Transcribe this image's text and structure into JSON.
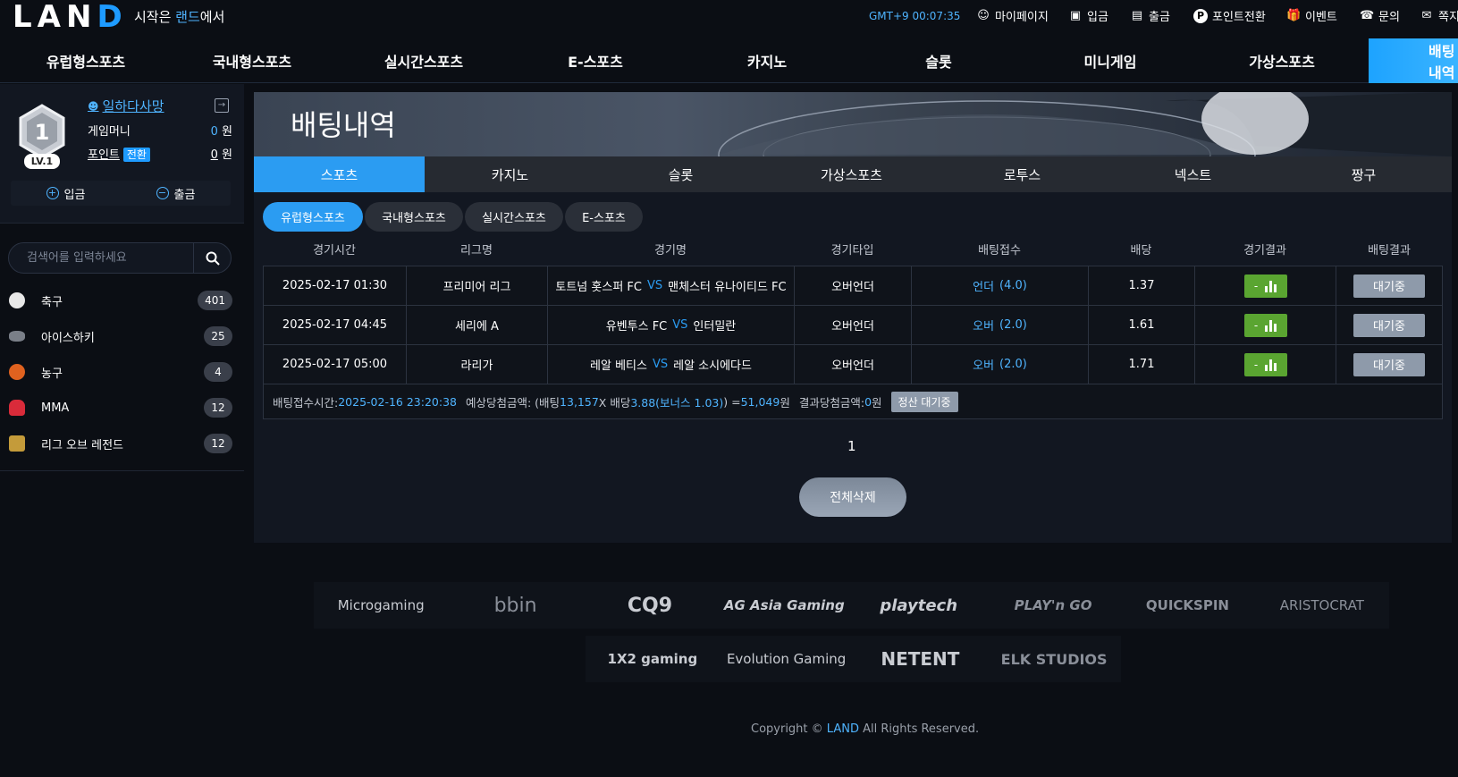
{
  "header": {
    "logo": "LAN",
    "logo_last": "D",
    "slogan_pre": "시작은 ",
    "slogan_brand": "랜드",
    "slogan_post": "에서",
    "clock": "GMT+9 00:07:35",
    "links": [
      {
        "label": "마이페이지",
        "icon": "user-icon"
      },
      {
        "label": "입금",
        "icon": "deposit-icon"
      },
      {
        "label": "출금",
        "icon": "withdraw-icon"
      },
      {
        "label": "포인트전환",
        "icon": "point-icon"
      },
      {
        "label": "이벤트",
        "icon": "gift-icon"
      },
      {
        "label": "문의",
        "icon": "headset-icon"
      },
      {
        "label": "쪽지",
        "icon": "mail-icon"
      }
    ]
  },
  "main_nav": {
    "items": [
      "유럽형스포츠",
      "국내형스포츠",
      "실시간스포츠",
      "E-스포츠",
      "카지노",
      "슬롯",
      "미니게임",
      "가상스포츠"
    ],
    "active": "배팅내역"
  },
  "user": {
    "level_num": "1",
    "level": "LV.1",
    "name": "일하다사망",
    "game_money_label": "게임머니",
    "game_money": "0",
    "currency": "원",
    "point_label": "포인트",
    "convert_label": "전환",
    "point": "0",
    "deposit_label": "입금",
    "withdraw_label": "출금"
  },
  "search": {
    "placeholder": "검색어를 입력하세요"
  },
  "sports": [
    {
      "name": "축구",
      "count": "401",
      "icon": "soccer-icon",
      "color": "#e8e8e8"
    },
    {
      "name": "아이스하키",
      "count": "25",
      "icon": "hockey-icon",
      "color": "#7a7f88"
    },
    {
      "name": "농구",
      "count": "4",
      "icon": "basketball-icon",
      "color": "#e0621f"
    },
    {
      "name": "MMA",
      "count": "12",
      "icon": "boxing-glove-icon",
      "color": "#d92b3a"
    },
    {
      "name": "리그 오브 레전드",
      "count": "12",
      "icon": "lol-icon",
      "color": "#c49b3a"
    }
  ],
  "page": {
    "title": "배팅내역",
    "categories": [
      "스포츠",
      "카지노",
      "슬롯",
      "가상스포츠",
      "로투스",
      "넥스트",
      "짱구"
    ],
    "subtabs": [
      "유럽형스포츠",
      "국내형스포츠",
      "실시간스포츠",
      "E-스포츠"
    ],
    "columns": [
      "경기시간",
      "리그명",
      "경기명",
      "경기타입",
      "배팅접수",
      "배당",
      "경기결과",
      "배팅결과"
    ],
    "rows": [
      {
        "time": "2025-02-17 01:30",
        "league": "프리미어 리그",
        "home": "토트넘 홋스퍼 FC",
        "vs": "VS",
        "away": "맨체스터 유나이티드 FC",
        "type": "오버언더",
        "pick": "언더",
        "pick_odd": "(4.0)",
        "odds": "1.37",
        "result": "-",
        "status": "대기중"
      },
      {
        "time": "2025-02-17 04:45",
        "league": "세리에 A",
        "home": "유벤투스 FC",
        "vs": "VS",
        "away": "인터밀란",
        "type": "오버언더",
        "pick": "오버",
        "pick_odd": "(2.0)",
        "odds": "1.61",
        "result": "-",
        "status": "대기중"
      },
      {
        "time": "2025-02-17 05:00",
        "league": "라리가",
        "home": "레알 베티스",
        "vs": "VS",
        "away": "레알 소시에다드",
        "type": "오버언더",
        "pick": "오버",
        "pick_odd": "(2.0)",
        "odds": "1.71",
        "result": "-",
        "status": "대기중"
      }
    ],
    "summary": {
      "time_label": "배팅접수시간: ",
      "time": "2025-02-16  23:20:38",
      "expected_label": "예상당첨금액: (배팅 ",
      "bet": "13,157",
      "x_label": " X 배당 ",
      "total_odds": "3.88(보너스  1.03)",
      "eq": ") = ",
      "expected": "51,049",
      "won": "원",
      "result_label": "결과당첨금액: ",
      "result_amount": "0",
      "result_won": "원",
      "settle": "정산 대기중"
    },
    "pagination": "1",
    "delete_all": "전체삭제"
  },
  "footer": {
    "providers_row1": [
      "Microgaming",
      "bbin",
      "CQ9",
      "AG Asia Gaming",
      "playtech",
      "PLAY'n GO",
      "QUICKSPIN",
      "ARISTOCRAT"
    ],
    "providers_row2": [
      "1X2 gaming",
      "Evolution Gaming",
      "NETENT",
      "ELK STUDIOS"
    ],
    "copyright_pre": "Copyright © ",
    "copyright_brand": "LAND",
    "copyright_post": " All Rights Reserved."
  },
  "colors": {
    "accent": "#1e9bff",
    "result_green": "#5aa531",
    "wait_gray": "#8e9aaa"
  }
}
